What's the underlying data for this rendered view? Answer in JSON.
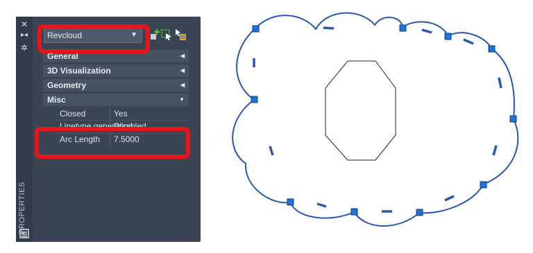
{
  "panel": {
    "strip_title": "PROPERTIES",
    "dropdown": {
      "value": "Revcloud"
    },
    "categories": [
      {
        "label": "General"
      },
      {
        "label": "3D Visualization"
      },
      {
        "label": "Geometry"
      },
      {
        "label": "Misc"
      }
    ],
    "misc_rows": [
      {
        "key": "Closed",
        "value": "Yes"
      },
      {
        "key": "Linetype generation",
        "value": "Disabled"
      },
      {
        "key": "Arc Length",
        "value": "7.5000"
      }
    ]
  },
  "colors": {
    "highlight": "#e8141b",
    "cloud_stroke": "#2a56b0",
    "grip": "#1f73d6"
  },
  "icons": {
    "strip": [
      "close-icon",
      "autohide-icon",
      "settings-icon"
    ],
    "toolbar": [
      "add-to-set-icon",
      "select-objects-icon",
      "quick-select-icon"
    ]
  }
}
